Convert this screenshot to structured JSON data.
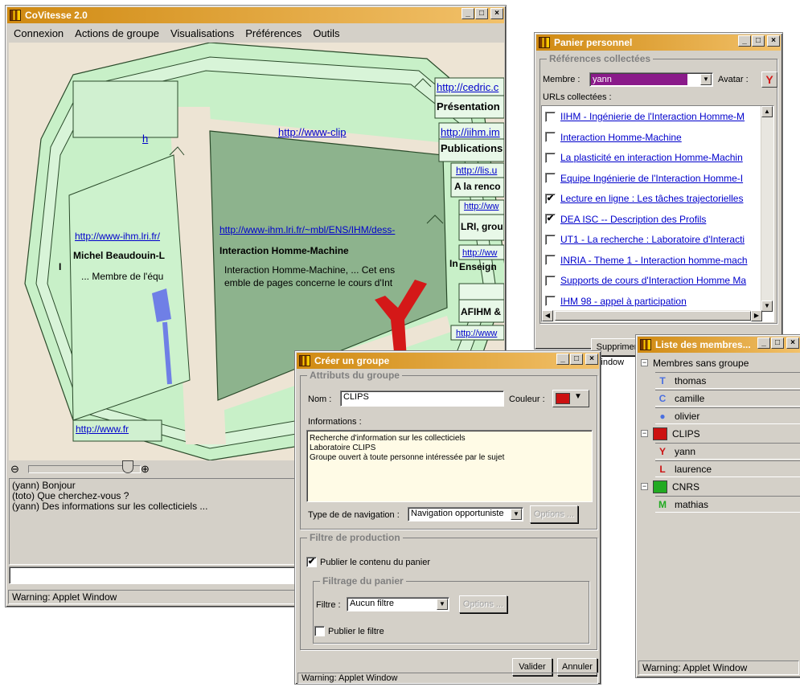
{
  "main": {
    "title": "CoVitesse 2.0",
    "menu": [
      "Connexion",
      "Actions de groupe",
      "Visualisations",
      "Préférences",
      "Outils"
    ],
    "viz": {
      "links": [
        "http://cedric.c",
        "http://iihm.im",
        "http://lis.u",
        "http://ww",
        "http://ww",
        "http://www",
        "http://www-clip",
        "h",
        "http://www-ihm.lri.fr/",
        "http://www-ihm.lri.fr/~mbl/ENS/IHM/dess-",
        "http://www.fr"
      ],
      "titles": [
        "Présentation",
        "Publications",
        "A la renco",
        "LRI, grou",
        "Enseign",
        "AFIHM &",
        "Michel Beaudouin-L",
        "Interaction Homme-Machine",
        "In",
        "I"
      ],
      "snippets": [
        "... Membre de l'équ",
        "Interaction Homme-Machine, ... Cet ens",
        "emble de pages concerne le cours d'Int"
      ]
    },
    "chat": [
      "(yann) Bonjour",
      "(toto) Que cherchez-vous ?",
      "(yann) Des informations sur les collecticiels ..."
    ],
    "status": "Warning: Applet Window"
  },
  "panier": {
    "title": "Panier personnel",
    "group_title": "Références collectées",
    "member_label": "Membre :",
    "member_value": "yann",
    "avatar_label": "Avatar :",
    "urls_label": "URLs collectées :",
    "urls": [
      {
        "text": "IIHM - Ingénierie de l'Interaction Homme-M",
        "checked": false
      },
      {
        "text": "Interaction Homme-Machine",
        "checked": false
      },
      {
        "text": "La plasticité en interaction Homme-Machin",
        "checked": false
      },
      {
        "text": "Equipe Ingénierie de l'Interaction Homme-I",
        "checked": false
      },
      {
        "text": "Lecture en ligne : Les tâches trajectorielles",
        "checked": true
      },
      {
        "text": "DEA ISC -- Description des Profils",
        "checked": true
      },
      {
        "text": "UT1 - La recherche : Laboratoire d'Interacti",
        "checked": false
      },
      {
        "text": "INRIA - Theme 1 - Interaction homme-mach",
        "checked": false
      },
      {
        "text": "Supports de cours d'Interaction Homme Ma",
        "checked": false
      },
      {
        "text": "IHM 98 - appel à participation",
        "checked": false
      }
    ],
    "delete_btn": "Supprimer",
    "status": "Window"
  },
  "creer": {
    "title": "Créer un groupe",
    "attrs_title": "Attributs du groupe",
    "name_label": "Nom :",
    "name_value": "CLIPS",
    "color_label": "Couleur :",
    "color": "#cc1111",
    "info_label": "Informations :",
    "info_lines": [
      "Recherche d'information sur les collecticiels",
      "Laboratoire CLIPS",
      "Groupe ouvert à toute personne intéressée par le sujet"
    ],
    "nav_label": "Type de de navigation :",
    "nav_value": "Navigation opportuniste",
    "options_btn": "Options ...",
    "filter_title": "Filtre de production",
    "publish_basket": "Publier le contenu du panier",
    "basket_filter_title": "Filtrage du panier",
    "filter_label": "Filtre :",
    "filter_value": "Aucun filtre",
    "publish_filter": "Publier le filtre",
    "ok_btn": "Valider",
    "cancel_btn": "Annuler",
    "status": "Warning: Applet Window"
  },
  "membres": {
    "title": "Liste des membres...",
    "groups": [
      {
        "name": "Membres sans groupe",
        "color": "",
        "members": [
          {
            "name": "thomas",
            "color": "#4a6fe0"
          },
          {
            "name": "camille",
            "color": "#4a6fe0"
          },
          {
            "name": "olivier",
            "color": "#4a6fe0"
          }
        ]
      },
      {
        "name": "CLIPS",
        "color": "#cc1111",
        "members": [
          {
            "name": "yann",
            "color": "#cc1111"
          },
          {
            "name": "laurence",
            "color": "#cc1111"
          }
        ]
      },
      {
        "name": "CNRS",
        "color": "#22aa22",
        "members": [
          {
            "name": "mathias",
            "color": "#22aa22"
          }
        ]
      }
    ],
    "status": "Warning: Applet Window"
  }
}
